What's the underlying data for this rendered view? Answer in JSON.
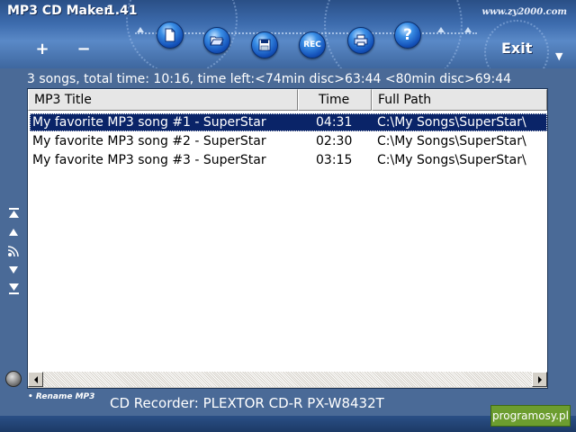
{
  "app": {
    "title": "MP3 CD Maker",
    "version": "1.41",
    "website": "www.zy2000.com",
    "exit_label": "Exit",
    "toolbar": {
      "plus": "+",
      "minus": "−",
      "buttons": [
        {
          "name": "new-icon"
        },
        {
          "name": "open-folder-icon"
        },
        {
          "name": "save-icon"
        },
        {
          "name": "rec-icon",
          "label": "REC"
        },
        {
          "name": "printer-icon"
        },
        {
          "name": "help-icon",
          "label": "?"
        }
      ]
    }
  },
  "status": {
    "summary": "3 songs, total time: 10:16, time left:<74min disc>63:44 <80min disc>69:44"
  },
  "list": {
    "columns": [
      "MP3 Title",
      "Time",
      "Full Path"
    ],
    "rows": [
      {
        "title": "My favorite MP3 song #1 - SuperStar",
        "time": "04:31",
        "path": "C:\\My Songs\\SuperStar\\",
        "selected": true
      },
      {
        "title": "My favorite MP3 song #2 - SuperStar",
        "time": "02:30",
        "path": "C:\\My Songs\\SuperStar\\",
        "selected": false
      },
      {
        "title": "My favorite MP3 song #3 - SuperStar",
        "time": "03:15",
        "path": "C:\\My Songs\\SuperStar\\",
        "selected": false
      }
    ]
  },
  "side_nav": [
    "move-top-icon",
    "move-up-icon",
    "broadcast-icon",
    "move-down-icon",
    "move-bottom-icon"
  ],
  "footer": {
    "rename_label": "• Rename MP3",
    "recorder": "CD Recorder: PLEXTOR CD-R   PX-W8432T",
    "watermark": "programosy.pl"
  },
  "colors": {
    "background": "#4a6a97",
    "selection": "#0a2468",
    "toolbar_button": "#1350b8",
    "watermark_bg": "#6c9d2f"
  }
}
